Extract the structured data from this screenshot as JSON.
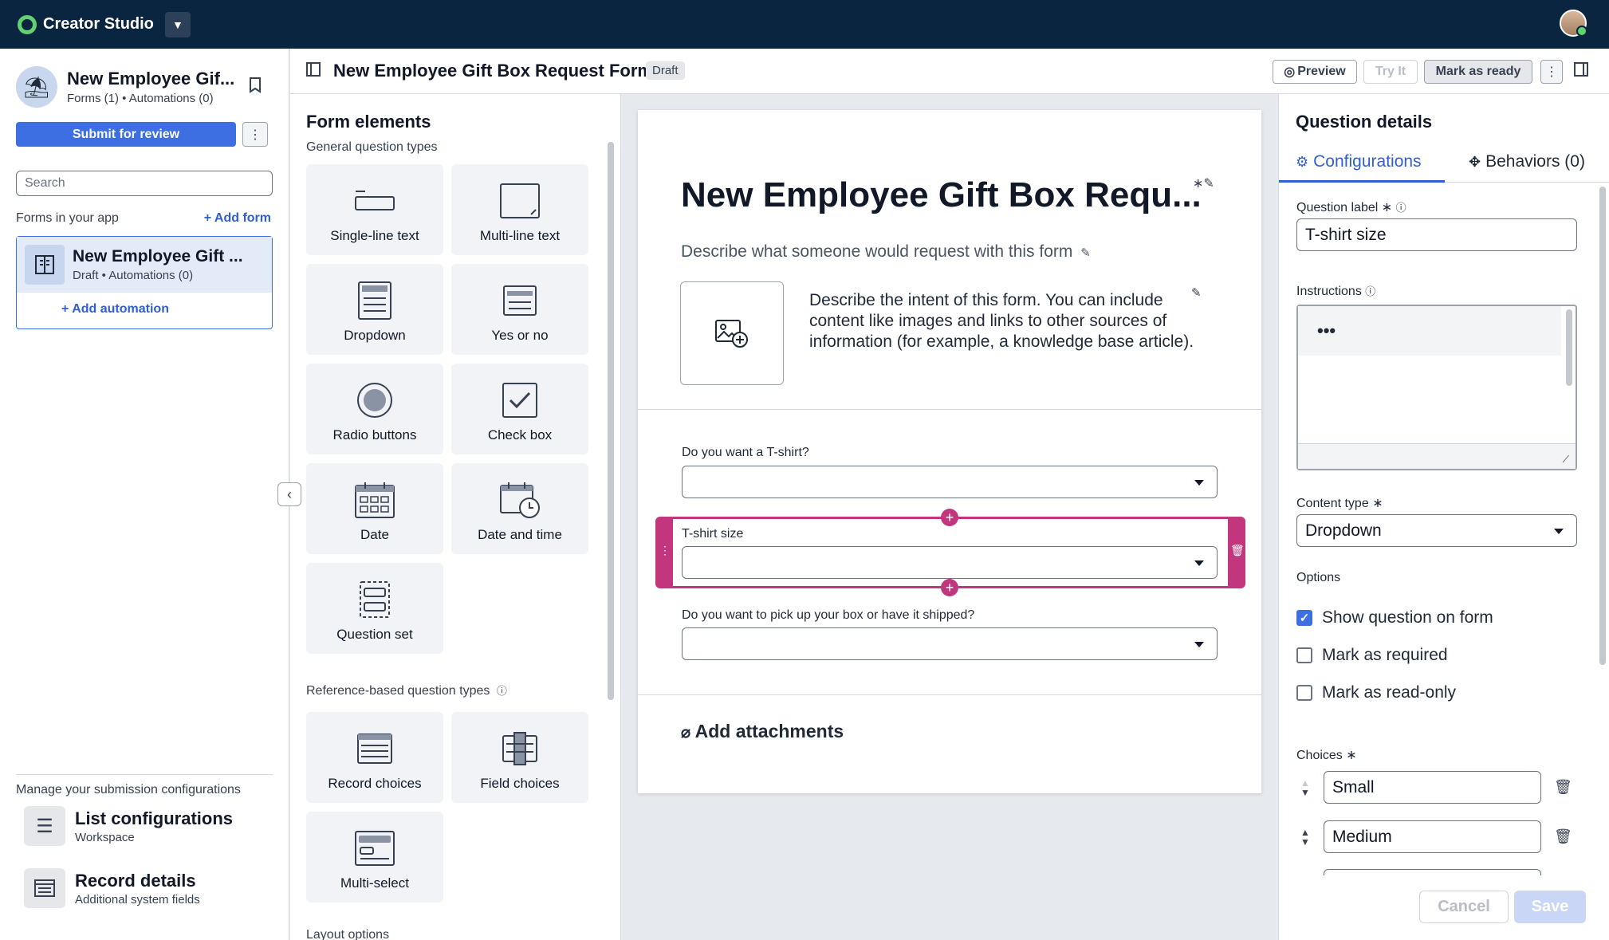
{
  "topbar": {
    "app_name": "Creator Studio",
    "dropdown_icon": "caret-down-icon"
  },
  "app": {
    "title": "New Employee Gif...",
    "subtitle": "Forms (1) • Automations (0)",
    "submit_label": "Submit for review",
    "search_placeholder": "Search",
    "forms_label": "Forms in your app",
    "add_form_label": "+ Add form",
    "form_card": {
      "title": "New Employee Gift ...",
      "subtitle": "Draft • Automations (0)",
      "add_automation": "+ Add automation"
    },
    "manage_label": "Manage your submission configurations",
    "links": [
      {
        "title": "List configurations",
        "subtitle": "Workspace"
      },
      {
        "title": "Record details",
        "subtitle": "Additional system fields"
      }
    ]
  },
  "header": {
    "form_name": "New Employee Gift Box Request Form",
    "status": "Draft",
    "preview": "Preview",
    "try_it": "Try It",
    "mark_ready": "Mark as ready"
  },
  "elements": {
    "title": "Form elements",
    "general_label": "General question types",
    "reference_label": "Reference-based question types",
    "layout_label": "Layout options",
    "general": [
      "Single-line text",
      "Multi-line text",
      "Dropdown",
      "Yes or no",
      "Radio buttons",
      "Check box",
      "Date",
      "Date and time",
      "Question set"
    ],
    "reference": [
      "Record choices",
      "Field choices",
      "Multi-select"
    ]
  },
  "canvas": {
    "title": "New Employee Gift Box Requ...",
    "description": "Describe what someone would request with this form",
    "intent": "Describe the intent of this form. You can include content like images and links to other sources of information (for example, a knowledge base article).",
    "questions": [
      {
        "label": "Do you want a T-shirt?"
      },
      {
        "label": "T-shirt size"
      },
      {
        "label": "Do you want to pick up your box or have it shipped?"
      }
    ],
    "attachments": "Add attachments"
  },
  "details": {
    "title": "Question details",
    "tab_config": "Configurations",
    "tab_behaviors": "Behaviors (0)",
    "question_label_title": "Question label",
    "question_label_value": "T-shirt size",
    "instructions_title": "Instructions",
    "content_type_title": "Content type",
    "content_type_value": "Dropdown",
    "options_title": "Options",
    "options": [
      {
        "label": "Show question on form",
        "checked": true
      },
      {
        "label": "Mark as required",
        "checked": false
      },
      {
        "label": "Mark as read-only",
        "checked": false
      }
    ],
    "choices_title": "Choices",
    "choices": [
      "Small",
      "Medium"
    ],
    "cancel": "Cancel",
    "save": "Save"
  },
  "colors": {
    "topbar": "#0a2540",
    "accent": "#3d6fe3",
    "selected_question": "#c2367e"
  }
}
